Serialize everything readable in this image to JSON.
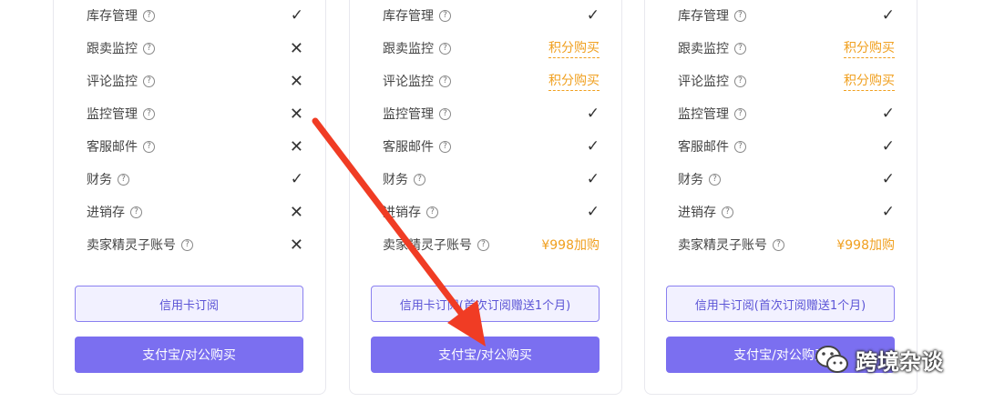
{
  "plans": [
    {
      "features": [
        {
          "name": "库存管理",
          "status": "✓"
        },
        {
          "name": "跟卖监控",
          "status": "✕"
        },
        {
          "name": "评论监控",
          "status": "✕"
        },
        {
          "name": "监控管理",
          "status": "✕"
        },
        {
          "name": "客服邮件",
          "status": "✕"
        },
        {
          "name": "财务",
          "status": "✓"
        },
        {
          "name": "进销存",
          "status": "✕"
        },
        {
          "name": "卖家精灵子账号",
          "status": "✕"
        }
      ],
      "card_button": "信用卡订阅",
      "pay_button": "支付宝/对公购买"
    },
    {
      "features": [
        {
          "name": "库存管理",
          "status": "✓"
        },
        {
          "name": "跟卖监控",
          "status": "积分购买"
        },
        {
          "name": "评论监控",
          "status": "积分购买"
        },
        {
          "name": "监控管理",
          "status": "✓"
        },
        {
          "name": "客服邮件",
          "status": "✓"
        },
        {
          "name": "财务",
          "status": "✓"
        },
        {
          "name": "进销存",
          "status": "✓"
        },
        {
          "name": "卖家精灵子账号",
          "status": "¥998加购"
        }
      ],
      "card_button": "信用卡订阅(首次订阅赠送1个月)",
      "pay_button": "支付宝/对公购买"
    },
    {
      "features": [
        {
          "name": "库存管理",
          "status": "✓"
        },
        {
          "name": "跟卖监控",
          "status": "积分购买"
        },
        {
          "name": "评论监控",
          "status": "积分购买"
        },
        {
          "name": "监控管理",
          "status": "✓"
        },
        {
          "name": "客服邮件",
          "status": "✓"
        },
        {
          "name": "财务",
          "status": "✓"
        },
        {
          "name": "进销存",
          "status": "✓"
        },
        {
          "name": "卖家精灵子账号",
          "status": "¥998加购"
        }
      ],
      "card_button": "信用卡订阅(首次订阅赠送1个月)",
      "pay_button": "支付宝/对公购买"
    }
  ],
  "help_glyph": "?",
  "watermark": {
    "text": "跨境杂谈",
    "icon": "wechat-icon"
  },
  "colors": {
    "accent": "#7b6ff0",
    "buy": "#f0a020",
    "arrow": "#f03c24"
  }
}
